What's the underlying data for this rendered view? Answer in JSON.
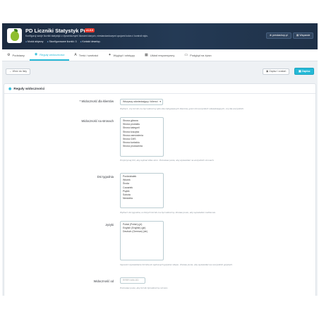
{
  "header": {
    "title": "PD Liczniki Statystyk Pro",
    "version": "v1.0.0",
    "subtitle": "Konfiguruj swoje liczniki statystyk z dynamicznymi ikonami danych, niestandardowymi opcjami koloru i kontroli stylu.",
    "links": [
      {
        "icon": "●",
        "label": "Moduł aktywny"
      },
      {
        "icon": "●",
        "label": "Skonfigurowane liczniki: 3"
      },
      {
        "icon": "●",
        "label": "Kontakt dewelop."
      }
    ],
    "btn_prestashop": "prestashop.pl",
    "btn_support": "Wsparcie"
  },
  "tabs": [
    {
      "icon": "⚙",
      "label": "Podstawy"
    },
    {
      "icon": "◉",
      "label": "Reguły widoczności"
    },
    {
      "icon": "A",
      "label": "Treść i wartości"
    },
    {
      "icon": "✦",
      "label": "Wygląd i odstępy"
    },
    {
      "icon": "▦",
      "label": "Układ responsywny"
    },
    {
      "icon": "▭",
      "label": "Podgląd na żywo"
    }
  ],
  "toolbar": {
    "back_label": "Wróć do listy",
    "save_stay_label": "Zapisz i zostań",
    "save_label": "Zapisz"
  },
  "panel": {
    "title": "Reguły widoczności",
    "fields": {
      "client_visibility": {
        "label": "* Widoczność dla klientów",
        "value": "Wszyscy odwiedzający i klienci",
        "help": "Wybierz, czy licznik ma być widoczny tylko dla zalogowanych klientów, gości lub wszystkich odwiedzających, czy dla wszystkich."
      },
      "pages": {
        "label": "Widoczność na stronach",
        "options": [
          "Strona główna",
          "Strona produktu",
          "Strona kategorii",
          "Strona koszyka",
          "Strona zamówienia",
          "Strona CMS",
          "Strona kontaktu",
          "Strona producenta"
        ],
        "help": "Przytrzymaj Ctrl, aby wybrać kilka stron. Pozostaw puste, aby wyświetlać na wszystkich stronach."
      },
      "weekdays": {
        "label": "Dni tygodnia",
        "options": [
          "Poniedziałek",
          "Wtorek",
          "Środa",
          "Czwartek",
          "Piątek",
          "Sobota",
          "Niedziela"
        ],
        "help": "Wybierz dni tygodnia, w których licznik ma być widoczny. Zostaw puste, aby wyświetlać codziennie."
      },
      "languages": {
        "label": "Języki",
        "options": [
          "Polski (Polish) (pl)",
          "English (English) (gb)",
          "Deutsch (German) (de)"
        ],
        "help": "Ogranicz wyświetlanie licznika do wybranych języków sklepu. Zostaw puste, aby wyświetlać we wszystkich językach."
      },
      "visible_from": {
        "label": "Widoczność od",
        "placeholder": "RRRR-MM-DD",
        "help": "Pozostaw puste, aby licznik był widoczny od razu."
      }
    }
  }
}
